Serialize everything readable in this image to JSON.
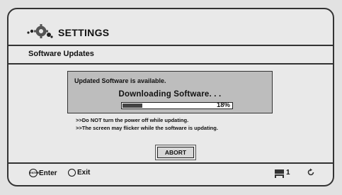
{
  "header": {
    "title": "SETTINGS",
    "icon": "settings-gear-icon"
  },
  "section": {
    "title": "Software Updates"
  },
  "panel": {
    "message": "Updated Software is available.",
    "status": "Downloading Software. . .",
    "progress_percent": 18,
    "progress_label": "18%"
  },
  "notes": [
    ">>Do NOT turn the power off while updating.",
    ">>The screen may flicker while the software is updating."
  ],
  "abort_label": "ABORT",
  "footer": {
    "enter_icon_text": "ENTER",
    "enter_label": "Enter",
    "exit_label": "Exit",
    "disc_count": "1",
    "icons": [
      "enter-button-icon",
      "exit-button-icon",
      "disc-tray-icon",
      "reload-icon"
    ]
  }
}
